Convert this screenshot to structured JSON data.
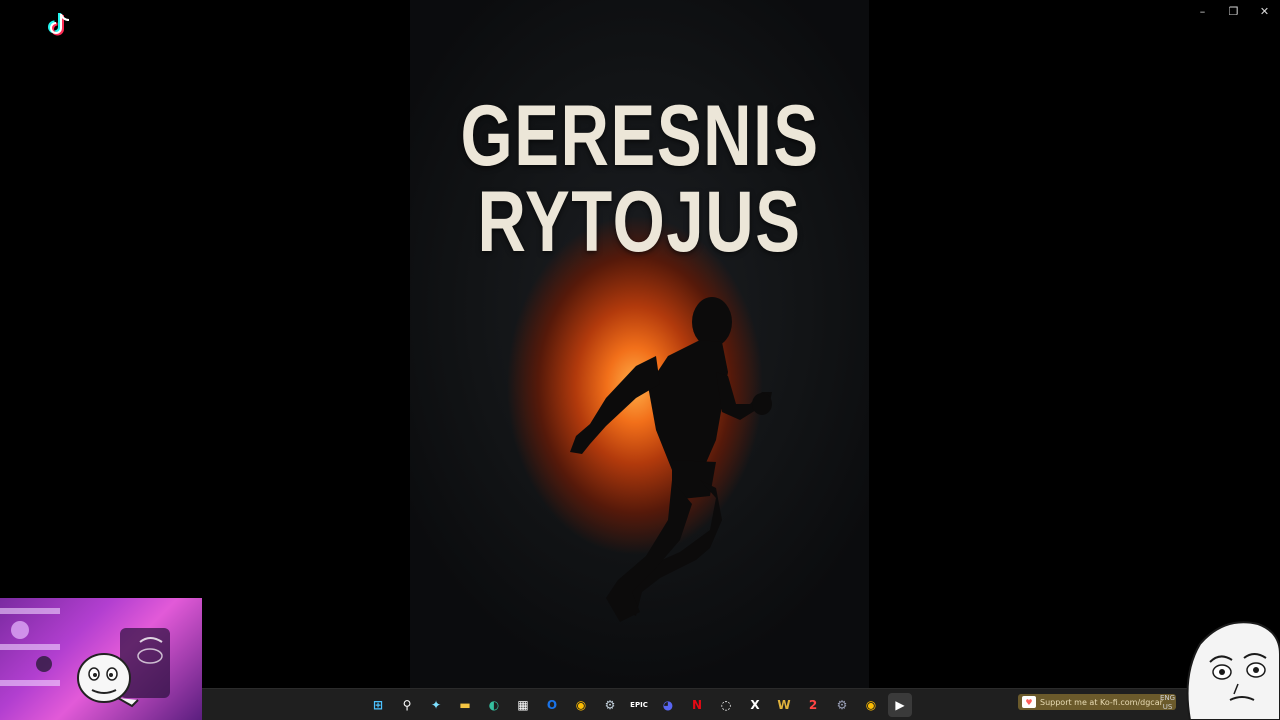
{
  "app": {
    "logo_icon": "tiktok-icon"
  },
  "window_controls": {
    "minimize": "–",
    "restore": "❐",
    "close": "✕"
  },
  "poster": {
    "title_line1": "GERESNIS",
    "title_line2": "RYTOJUS",
    "image_subject": "running-man-silhouette"
  },
  "webcam": {
    "overlay_icon": "meme-face-icon"
  },
  "taskbar": {
    "icons": [
      {
        "name": "start-icon",
        "glyph": "⊞",
        "color": "#4cc2ff"
      },
      {
        "name": "search-icon",
        "glyph": "⚲",
        "color": "#ffffff"
      },
      {
        "name": "copilot-icon",
        "glyph": "✦",
        "color": "#7ee0ff"
      },
      {
        "name": "file-explorer-icon",
        "glyph": "▬",
        "color": "#f5c542"
      },
      {
        "name": "edge-icon",
        "glyph": "◐",
        "color": "#35c1a1"
      },
      {
        "name": "store-icon",
        "glyph": "▦",
        "color": "#ffffff"
      },
      {
        "name": "outlook-icon",
        "glyph": "O",
        "color": "#1a73e8"
      },
      {
        "name": "chrome-icon",
        "glyph": "◉",
        "color": "#fbbc04"
      },
      {
        "name": "steam-icon",
        "glyph": "⚙",
        "color": "#c7d5e0"
      },
      {
        "name": "epic-games-icon",
        "glyph": "EPIC",
        "color": "#ffffff"
      },
      {
        "name": "discord-icon",
        "glyph": "◕",
        "color": "#5865f2"
      },
      {
        "name": "netflix-icon",
        "glyph": "N",
        "color": "#e50914"
      },
      {
        "name": "obs-icon",
        "glyph": "◌",
        "color": "#ffffff"
      },
      {
        "name": "capcut-icon",
        "glyph": "X",
        "color": "#ffffff"
      },
      {
        "name": "world-of-warcraft-icon",
        "glyph": "W",
        "color": "#e0b23c"
      },
      {
        "name": "app-2-icon",
        "glyph": "2",
        "color": "#ff4444"
      },
      {
        "name": "settings-app-icon",
        "glyph": "⚙",
        "color": "#9aa0b8"
      },
      {
        "name": "chrome-profile-icon",
        "glyph": "◉",
        "color": "#fbbc04"
      },
      {
        "name": "media-player-icon",
        "glyph": "▶",
        "color": "#ffffff"
      }
    ]
  },
  "tray": {
    "kofi_text": "Support me at Ko-fi.com/dgcar",
    "lang_top": "ENG",
    "lang_bottom": "US"
  },
  "colors": {
    "background": "#000000",
    "taskbar": "#1f1f1f",
    "title": "#ece6d8",
    "glow": "#f2701a"
  }
}
